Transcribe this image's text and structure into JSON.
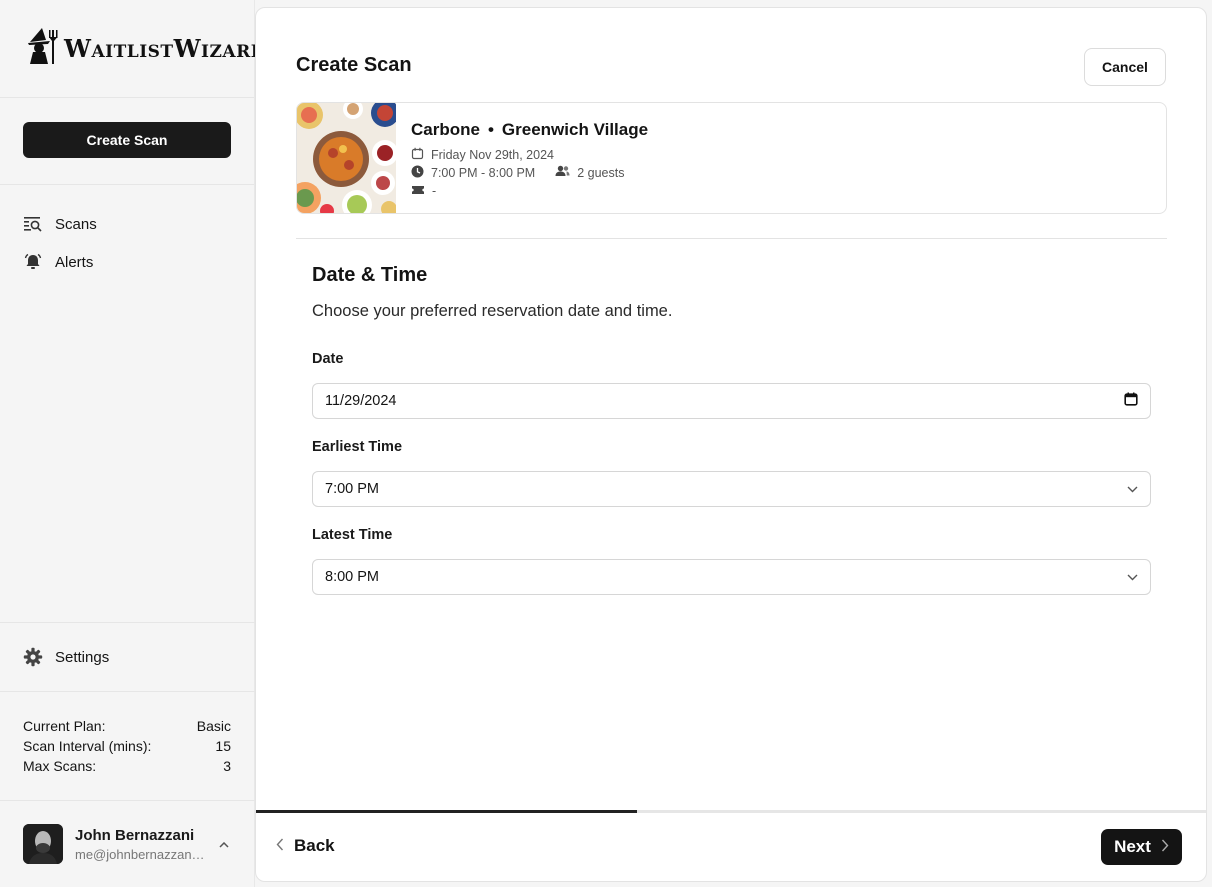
{
  "app": {
    "name": "WaitlistWizard"
  },
  "sidebar": {
    "create_label": "Create Scan",
    "items": [
      {
        "label": "Scans",
        "icon": "scan-list-icon"
      },
      {
        "label": "Alerts",
        "icon": "bell-icon"
      }
    ],
    "settings_label": "Settings",
    "plan": {
      "current_plan_label": "Current Plan:",
      "current_plan_value": "Basic",
      "interval_label": "Scan Interval (mins):",
      "interval_value": "15",
      "max_label": "Max Scans:",
      "max_value": "3"
    },
    "user": {
      "name": "John Bernazzani",
      "email": "me@johnbernazzani..."
    }
  },
  "main": {
    "title": "Create Scan",
    "cancel_label": "Cancel",
    "restaurant": {
      "name": "Carbone",
      "location": "Greenwich Village",
      "date": "Friday Nov 29th, 2024",
      "time": "7:00 PM - 8:00 PM",
      "guests": "2 guests",
      "seating": "-"
    },
    "section_title": "Date & Time",
    "section_desc": "Choose your preferred reservation date and time.",
    "fields": {
      "date_label": "Date",
      "date_value": "11/29/2024",
      "earliest_label": "Earliest Time",
      "earliest_value": "7:00 PM",
      "latest_label": "Latest Time",
      "latest_value": "8:00 PM"
    },
    "progress_fraction": 0.4,
    "back_label": "Back",
    "next_label": "Next"
  }
}
